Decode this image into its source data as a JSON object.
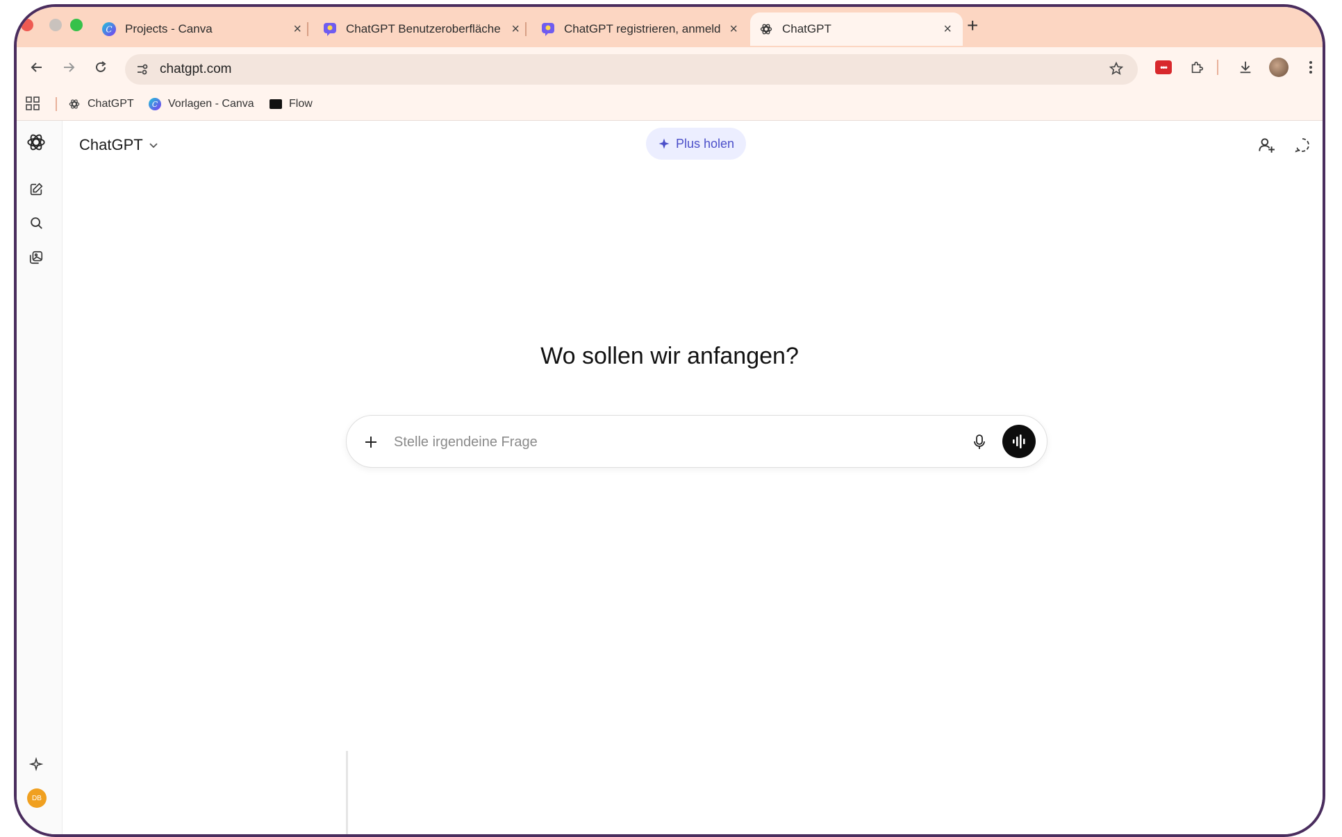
{
  "browser": {
    "tabs": [
      {
        "title": "Projects - Canva",
        "active": false,
        "icon": "canva-icon"
      },
      {
        "title": "ChatGPT Benutzeroberfläche",
        "active": false,
        "icon": "gpt-tool-icon"
      },
      {
        "title": "ChatGPT registrieren, anmeld",
        "active": false,
        "icon": "gpt-tool-icon"
      },
      {
        "title": "ChatGPT",
        "active": true,
        "icon": "openai-icon"
      }
    ],
    "close_glyph": "×",
    "new_tab_glyph": "+",
    "address": {
      "url": "chatgpt.com"
    },
    "extension_badge": "•••",
    "bookmarks": [
      {
        "label": "ChatGPT",
        "icon": "openai-icon"
      },
      {
        "label": "Vorlagen - Canva",
        "icon": "canva-icon"
      },
      {
        "label": "Flow",
        "icon": "flow-icon"
      }
    ]
  },
  "app": {
    "model_selector": {
      "label": "ChatGPT"
    },
    "upgrade_button": {
      "label": "Plus holen"
    },
    "headline": "Wo sollen wir anfangen?",
    "composer": {
      "placeholder": "Stelle irgendeine Frage",
      "value": ""
    },
    "user_avatar": {
      "initials": "DB"
    }
  },
  "colors": {
    "tab_strip": "#fcd6c2",
    "toolbar": "#fff4ee",
    "upgrade_bg": "#eceeff",
    "upgrade_text": "#4b4fc9",
    "avatar": "#f0a020"
  }
}
